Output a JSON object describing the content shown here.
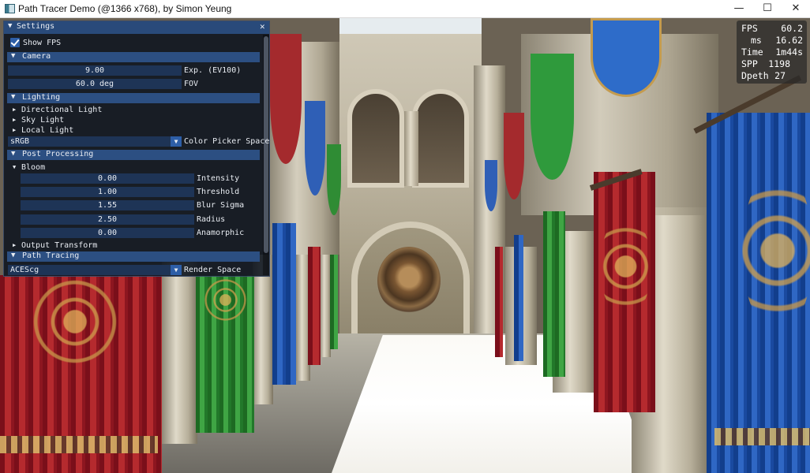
{
  "window": {
    "title": "Path Tracer Demo (@1366 x768), by Simon Yeung",
    "controls": {
      "minimize": "—",
      "maximize": "☐",
      "close": "✕"
    }
  },
  "stats": [
    {
      "label": "FPS",
      "value": "60.2"
    },
    {
      "label": "ms",
      "value": "16.62"
    },
    {
      "label": "Time",
      "value": "1m44s"
    },
    {
      "label": "SPP",
      "value": "1198"
    },
    {
      "label": "Dpeth",
      "value": "27"
    }
  ],
  "settings": {
    "title": "Settings",
    "show_fps": {
      "label": "Show FPS",
      "checked": true
    },
    "camera": {
      "header": "Camera",
      "exposure": {
        "value": "9.00",
        "label": "Exp. (EV100)"
      },
      "fov": {
        "value": "60.0 deg",
        "label": "FOV"
      }
    },
    "lighting": {
      "header": "Lighting",
      "items": [
        "Directional Light",
        "Sky Light",
        "Local Light"
      ],
      "color_picker": {
        "value": "sRGB",
        "label": "Color Picker Space"
      }
    },
    "post_processing": {
      "header": "Post Processing",
      "bloom": {
        "header": "Bloom",
        "params": [
          {
            "value": "0.00",
            "label": "Intensity"
          },
          {
            "value": "1.00",
            "label": "Threshold"
          },
          {
            "value": "1.55",
            "label": "Blur Sigma"
          },
          {
            "value": "2.50",
            "label": "Radius"
          },
          {
            "value": "0.00",
            "label": "Anamorphic"
          }
        ]
      },
      "output_transform": "Output Transform"
    },
    "path_tracing": {
      "header": "Path Tracing",
      "render_space": {
        "value": "ACEScg",
        "label": "Render Space"
      }
    }
  },
  "icons": {
    "tree_open": "▼",
    "tree_closed": "▶",
    "combo_arrow": "▼"
  }
}
